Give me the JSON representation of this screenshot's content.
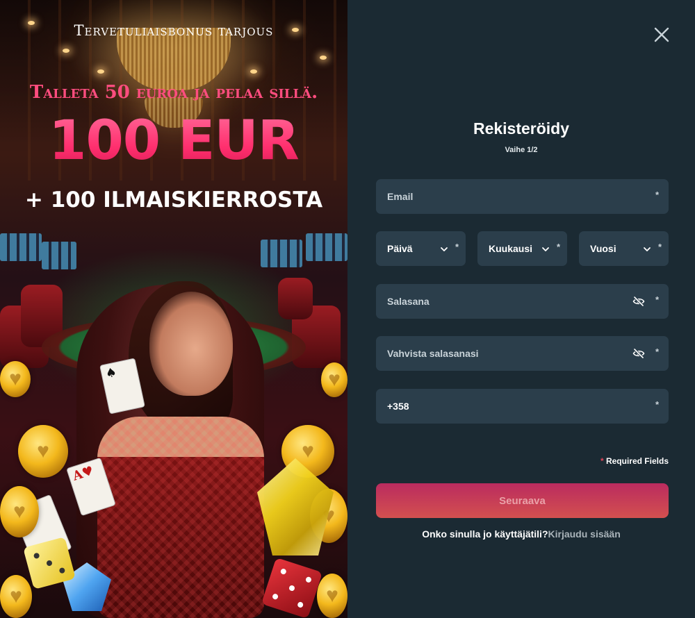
{
  "promo": {
    "offer_label": "Tervetuliaisbonus tarjous",
    "headline": "Talleta 50 euroa ja pelaa sillä.",
    "amount": "100 EUR",
    "free_spins": "+ 100 ILMAISKIERROSTA",
    "colors": {
      "headline": "#ff4d7f",
      "amount": "#ff2f6e"
    }
  },
  "form": {
    "title": "Rekisteröidy",
    "step": "Vaihe 1/2",
    "email_placeholder": "Email",
    "day_label": "Päivä",
    "month_label": "Kuukausi",
    "year_label": "Vuosi",
    "password_placeholder": "Salasana",
    "confirm_password_placeholder": "Vahvista salasanasi",
    "phone_value": "+358",
    "required_star": "*",
    "required_note": "Required Fields",
    "submit_label": "Seuraava",
    "login_question": "Onko sinulla jo käyttäjätili?",
    "login_link": "Kirjaudu sisään",
    "icons": {
      "close": "close-icon",
      "chevron": "chevron-down-icon",
      "password_visibility": "eye-off-icon"
    },
    "colors": {
      "panel_bg": "#1b2a33",
      "field_bg": "#2b3e4b",
      "button_gradient_start": "#ba2b5f",
      "button_gradient_end": "#d3504f",
      "required_star": "#e0455a"
    }
  }
}
